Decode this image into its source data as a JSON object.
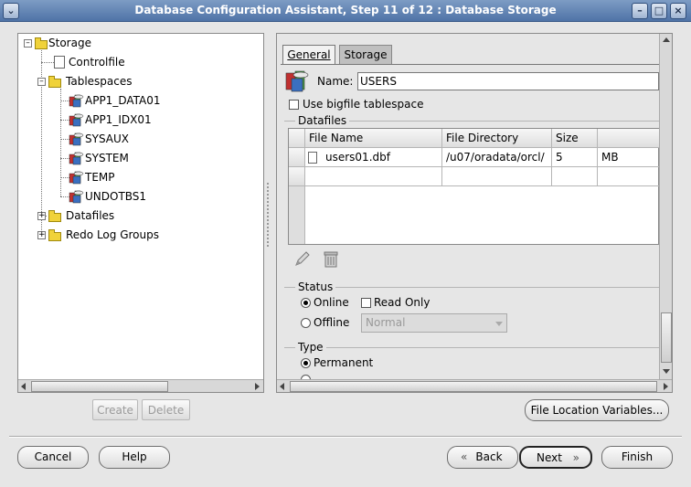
{
  "window": {
    "title": "Database Configuration Assistant, Step 11 of 12 : Database Storage",
    "menu_icon": "chevron-down-icon",
    "minimize_icon": "minimize-icon",
    "maximize_icon": "maximize-icon",
    "close_icon": "close-icon"
  },
  "tree": {
    "root": "Storage",
    "controlfile": "Controlfile",
    "tablespaces": "Tablespaces",
    "tablespace_items": [
      "APP1_DATA01",
      "APP1_IDX01",
      "SYSAUX",
      "SYSTEM",
      "TEMP",
      "UNDOTBS1"
    ],
    "datafiles": "Datafiles",
    "redo": "Redo Log Groups"
  },
  "left_buttons": {
    "create": "Create",
    "delete": "Delete"
  },
  "tabs": {
    "general": "General",
    "storage": "Storage",
    "active": "General"
  },
  "general": {
    "name_label": "Name:",
    "name_value": "USERS",
    "bigfile_label": "Use bigfile tablespace",
    "bigfile_checked": false,
    "datafiles_group": "Datafiles",
    "columns": [
      "File Name",
      "File Directory",
      "Size",
      ""
    ],
    "rows": [
      {
        "file_name": "users01.dbf",
        "directory": "/u07/oradata/orcl/",
        "size": "5",
        "unit": "MB"
      }
    ],
    "status_group": "Status",
    "online_label": "Online",
    "offline_label": "Offline",
    "status_selected": "Online",
    "readonly_label": "Read Only",
    "readonly_checked": false,
    "offline_mode": "Normal",
    "type_group": "Type",
    "permanent_label": "Permanent",
    "type_selected": "Permanent"
  },
  "bottom": {
    "file_location": "File Location Variables...",
    "cancel": "Cancel",
    "help": "Help",
    "back": "Back",
    "next": "Next",
    "finish": "Finish"
  },
  "colors": {
    "titlebar": "#4f73a7",
    "folder": "#f0d23a",
    "background": "#e6e6e6"
  }
}
